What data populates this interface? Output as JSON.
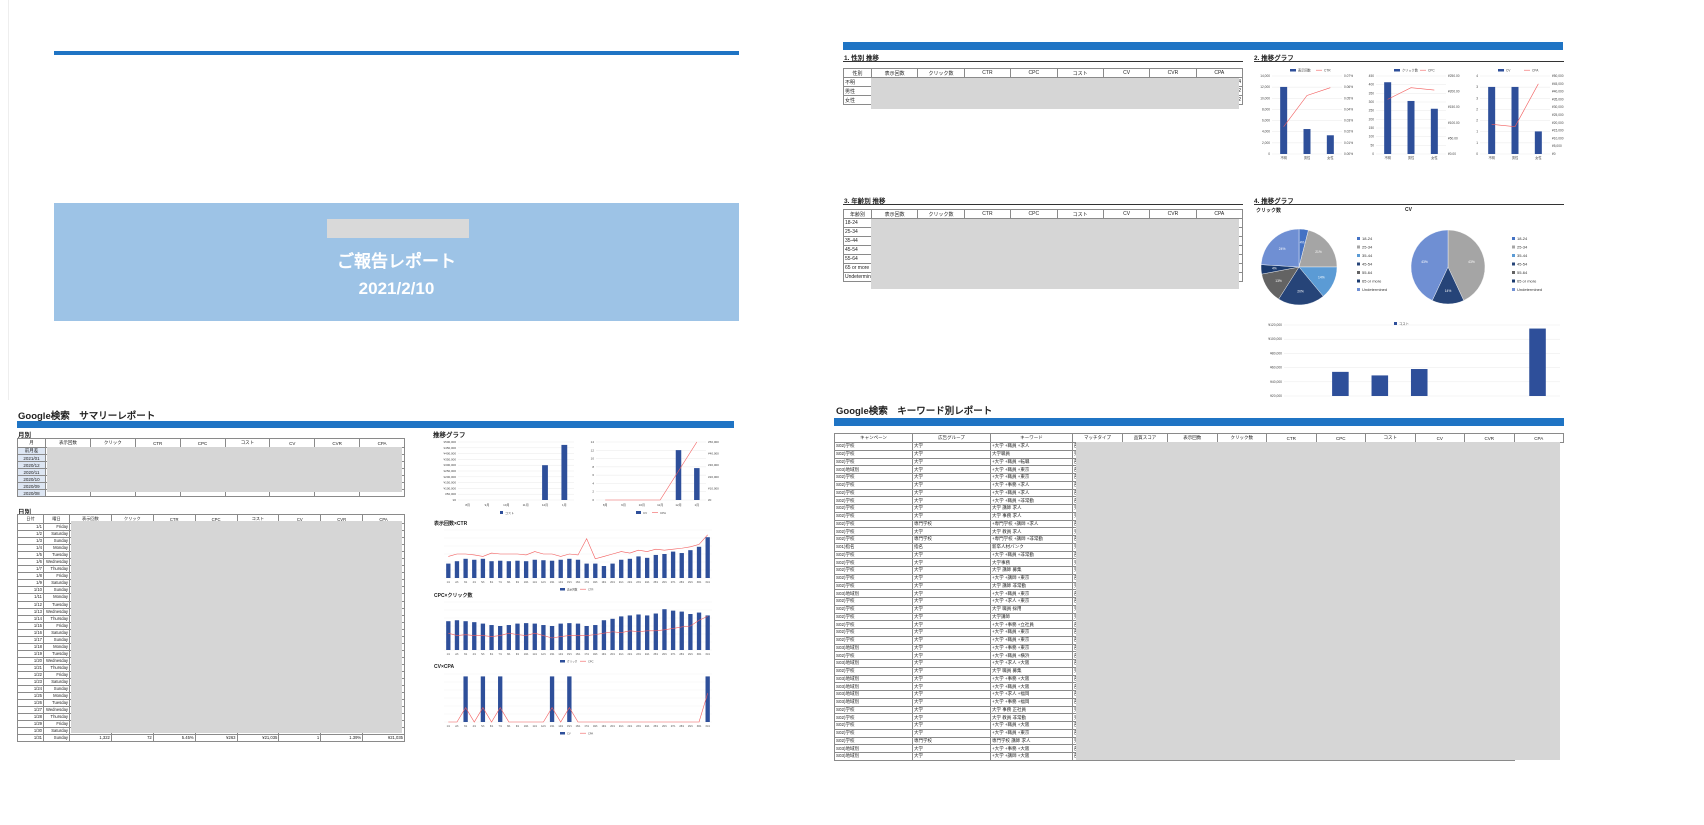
{
  "cover": {
    "title": "ご報告レポート",
    "date": "2021/2/10"
  },
  "gender": {
    "section": "1. 性別 推移",
    "graph_section": "2. 推移グラフ",
    "cols": [
      "性別",
      "表示回数",
      "クリック数",
      "CTR",
      "CPC",
      "コスト",
      "CV",
      "CVR",
      "CPA"
    ],
    "rows": [
      "不明",
      "男性",
      "女性"
    ],
    "right_vals": [
      "4",
      "2",
      "2"
    ],
    "charts": [
      {
        "legend": [
          "表示回数",
          "CTR"
        ],
        "yleft": [
          "14,000",
          "12,000",
          "10,000",
          "8,000",
          "6,000",
          "4,000",
          "2,000",
          "0"
        ],
        "yright": [
          "0.07%",
          "0.06%",
          "0.05%",
          "0.04%",
          "0.03%",
          "0.02%",
          "0.01%",
          "0.00%"
        ],
        "cats": [
          "不明",
          "男性",
          "女性"
        ],
        "values": [
          0.86,
          0.32,
          0.24
        ],
        "line": [
          0.35,
          0.75,
          0.85
        ]
      },
      {
        "legend": [
          "クリック数",
          "CPC"
        ],
        "yleft": [
          "450",
          "400",
          "350",
          "300",
          "250",
          "200",
          "150",
          "100",
          "50",
          "0"
        ],
        "yright": [
          "¥250.00",
          "¥200.00",
          "¥150.00",
          "¥100.00",
          "¥50.00",
          "¥0.00"
        ],
        "cats": [
          "不明",
          "男性",
          "女性"
        ],
        "values": [
          0.92,
          0.68,
          0.58
        ],
        "line": [
          0.7,
          0.85,
          0.82
        ]
      },
      {
        "legend": [
          "CV",
          "CPA"
        ],
        "yleft": [
          "4",
          "3",
          "3",
          "2",
          "2",
          "1",
          "1",
          "0"
        ],
        "yright": [
          "¥50,000",
          "¥45,000",
          "¥40,000",
          "¥35,000",
          "¥30,000",
          "¥25,000",
          "¥20,000",
          "¥15,000",
          "¥10,000",
          "¥5,000",
          "¥0"
        ],
        "cats": [
          "不明",
          "男性",
          "女性"
        ],
        "values": [
          0.86,
          0.86,
          0.29
        ],
        "line": [
          0.38,
          0.35,
          0.9
        ]
      }
    ]
  },
  "age": {
    "section": "3. 年齢別 推移",
    "graph_section": "4. 推移グラフ",
    "cols": [
      "年齢別",
      "表示回数",
      "クリック数",
      "CTR",
      "CPC",
      "コスト",
      "CV",
      "CVR",
      "CPA"
    ],
    "rows": [
      "18-24",
      "25-34",
      "35-44",
      "45-54",
      "55-64",
      "65 or more",
      "Undetermined"
    ],
    "pie1_title": "クリック数",
    "pie2_title": "CV",
    "legend": [
      "18-24",
      "25-34",
      "35-44",
      "45-54",
      "55-64",
      "65 or more",
      "Undetermined"
    ],
    "pie1": [
      4,
      21,
      14,
      20,
      13,
      4,
      24
    ],
    "pie1_labels": [
      "4%",
      "21%",
      "14%",
      "20%",
      "13%",
      "4%",
      "24%"
    ],
    "pie2": [
      0,
      43,
      0,
      14,
      0,
      0,
      43
    ],
    "pie2_labels": [
      "0%",
      "43%",
      "14%",
      "0%",
      "0%",
      "43%"
    ],
    "bar_legend": "コスト",
    "bar_y": [
      "¥120,000",
      "¥100,000",
      "¥80,000",
      "¥60,000",
      "¥40,000",
      "¥20,000"
    ],
    "bar_values": [
      0,
      0.34,
      0.29,
      0.38,
      0,
      0,
      0.95
    ]
  },
  "summary": {
    "title": "Google検索　サマリーレポート",
    "monthly_label": "月別",
    "daily_label": "日別",
    "graph_label": "推移グラフ",
    "monthly_cols": [
      "月",
      "表示回数",
      "クリック",
      "CTR",
      "CPC",
      "コスト",
      "CV",
      "CVR",
      "CPA"
    ],
    "months": [
      "前月差",
      "2021/01",
      "2020/12",
      "2020/11",
      "2020/10",
      "2020/09",
      "2020/08"
    ],
    "daily_cols": [
      "日付",
      "曜日",
      "表示回数",
      "クリック",
      "CTR",
      "CPC",
      "コスト",
      "CV",
      "CVR",
      "CPA"
    ],
    "days": [
      [
        "1/1",
        "Friday"
      ],
      [
        "1/2",
        "Saturday"
      ],
      [
        "1/3",
        "Sunday"
      ],
      [
        "1/4",
        "Monday"
      ],
      [
        "1/5",
        "Tuesday"
      ],
      [
        "1/6",
        "Wednesday"
      ],
      [
        "1/7",
        "Thursday"
      ],
      [
        "1/8",
        "Friday"
      ],
      [
        "1/9",
        "Saturday"
      ],
      [
        "1/10",
        "Sunday"
      ],
      [
        "1/11",
        "Monday"
      ],
      [
        "1/12",
        "Tuesday"
      ],
      [
        "1/13",
        "Wednesday"
      ],
      [
        "1/14",
        "Thursday"
      ],
      [
        "1/15",
        "Friday"
      ],
      [
        "1/16",
        "Saturday"
      ],
      [
        "1/17",
        "Sunday"
      ],
      [
        "1/18",
        "Monday"
      ],
      [
        "1/19",
        "Tuesday"
      ],
      [
        "1/20",
        "Wednesday"
      ],
      [
        "1/21",
        "Thursday"
      ],
      [
        "1/22",
        "Friday"
      ],
      [
        "1/23",
        "Saturday"
      ],
      [
        "1/24",
        "Sunday"
      ],
      [
        "1/25",
        "Monday"
      ],
      [
        "1/26",
        "Tuesday"
      ],
      [
        "1/27",
        "Wednesday"
      ],
      [
        "1/28",
        "Thursday"
      ],
      [
        "1/29",
        "Friday"
      ],
      [
        "1/30",
        "Saturday"
      ]
    ],
    "last_row": [
      "1/31",
      "Sunday",
      "1,322",
      "72",
      "5.45%",
      "¥263",
      "¥21,035",
      "1",
      "1.39%",
      "¥21,035"
    ],
    "chart1": {
      "y": [
        "¥500,000",
        "¥450,000",
        "¥400,000",
        "¥350,000",
        "¥300,000",
        "¥250,000",
        "¥200,000",
        "¥150,000",
        "¥100,000",
        "¥50,000",
        "¥0"
      ],
      "x": [
        "8月",
        "9月",
        "10月",
        "11月",
        "12月",
        "1月"
      ],
      "values": [
        0,
        0,
        0,
        0,
        0.6,
        0.95
      ],
      "legend": "コスト"
    },
    "chart2": {
      "yl": [
        "14",
        "12",
        "10",
        "8",
        "6",
        "4",
        "2",
        "0"
      ],
      "yr": [
        "¥50,000",
        "¥40,000",
        "¥30,000",
        "¥20,000",
        "¥10,000",
        "¥0"
      ],
      "x": [
        "8月",
        "9月",
        "10月",
        "11月",
        "12月",
        "1月"
      ],
      "values": [
        0,
        0,
        0,
        0,
        0.86,
        0.55
      ],
      "line": [
        0,
        0,
        0,
        0,
        0.5,
        1.0
      ],
      "legend": [
        "CV",
        "CPA"
      ]
    },
    "chart3_title": "表示回数×CTR",
    "chart4_title": "CPC×クリック数",
    "chart5_title": "CV×CPA",
    "c3_legend": [
      "表示回数",
      "CTR"
    ],
    "c4_legend": [
      "クリック",
      "CPC"
    ],
    "c5_legend": [
      "CV",
      "CPA"
    ]
  },
  "keyword": {
    "title": "Google検索　キーワード別レポート",
    "cols": [
      "キャンペーン",
      "広告グループ",
      "キーワード",
      "マッチタイプ",
      "品質スコア",
      "表示回数",
      "クリック数",
      "CTR",
      "CPC",
      "コスト",
      "CV",
      "CVR",
      "CPA"
    ],
    "rows": [
      [
        "S02)学校",
        "大学",
        "+大学 +職員 +求人",
        "部"
      ],
      [
        "S02)学校",
        "大学",
        "大学職員",
        "完"
      ],
      [
        "S02)学校",
        "大学",
        "+大学 +職員 +転職",
        "部"
      ],
      [
        "S03)地域別",
        "大学",
        "+大学 +職員 +東京",
        "部"
      ],
      [
        "S02)学校",
        "大学",
        "+大学 +職員 +東京",
        "部"
      ],
      [
        "S02)学校",
        "大学",
        "+大学 +事務 +求人",
        "部"
      ],
      [
        "S02)学校",
        "大学",
        "+大学 +職員 +求人",
        "部"
      ],
      [
        "S02)学校",
        "大学",
        "+大学 +職員 +非常勤",
        "部"
      ],
      [
        "S02)学校",
        "大学",
        "大学 講師 求人",
        "完"
      ],
      [
        "S02)学校",
        "大学",
        "大学 事務 求人",
        "完"
      ],
      [
        "S02)学校",
        "専門学校",
        "+専門学校 +講師 +求人",
        "部"
      ],
      [
        "S02)学校",
        "大学",
        "大学 教員 求人",
        "完"
      ],
      [
        "S02)学校",
        "専門学校",
        "+専門学校 +講師 +非常勤",
        "部"
      ],
      [
        "S01)指名",
        "指名",
        "新卒人材バンク",
        "完"
      ],
      [
        "S02)学校",
        "大学",
        "+大学 +職員 +非常勤",
        "部"
      ],
      [
        "S02)学校",
        "大学",
        "大学事務",
        "完"
      ],
      [
        "S02)学校",
        "大学",
        "大学 講師 募集",
        "完"
      ],
      [
        "S02)学校",
        "大学",
        "+大学 +講師 +東京",
        "部"
      ],
      [
        "S02)学校",
        "大学",
        "大学 講師 非常勤",
        "完"
      ],
      [
        "S03)地域別",
        "大学",
        "+大学 +職員 +東京",
        "部"
      ],
      [
        "S02)学校",
        "大学",
        "+大学 +求人 +東京",
        "部"
      ],
      [
        "S02)学校",
        "大学",
        "大学 職員 採用",
        "完"
      ],
      [
        "S02)学校",
        "大学",
        "大学講師",
        "完"
      ],
      [
        "S02)学校",
        "大学",
        "+大学 +事務 +立社員",
        "部"
      ],
      [
        "S02)学校",
        "大学",
        "+大学 +職員 +東京",
        "部"
      ],
      [
        "S02)学校",
        "大学",
        "+大学 +職員 +東京",
        "部"
      ],
      [
        "S03)地域別",
        "大学",
        "+大学 +事務 +東京",
        "部"
      ],
      [
        "S02)学校",
        "大学",
        "+大学 +職員 +横浜",
        "部"
      ],
      [
        "S03)地域別",
        "大学",
        "+大学 +求人 +大阪",
        "部"
      ],
      [
        "S02)学校",
        "大学",
        "大学 職員 募集",
        "完"
      ],
      [
        "S03)地域別",
        "大学",
        "+大学 +事務 +大阪",
        "部"
      ],
      [
        "S03)地域別",
        "大学",
        "+大学 +職員 +大阪",
        "部"
      ],
      [
        "S03)地域別",
        "大学",
        "+大学 +求人 +福岡",
        "部"
      ],
      [
        "S03)地域別",
        "大学",
        "+大学 +事務 +福岡",
        "部"
      ],
      [
        "S02)学校",
        "大学",
        "大学 事務 正社員",
        "完"
      ],
      [
        "S02)学校",
        "大学",
        "大学 教員 非常勤",
        "完"
      ],
      [
        "S02)学校",
        "大学",
        "+大学 +職員 +大阪",
        "部"
      ],
      [
        "S02)学校",
        "大学",
        "+大学 +職員 +東京",
        "部"
      ],
      [
        "S02)学校",
        "専門学校",
        "専門学校 講師 求人",
        "完"
      ],
      [
        "S03)地域別",
        "大学",
        "+大学 +事務 +大阪",
        "部"
      ],
      [
        "S03)地域別",
        "大学",
        "+大学 +講師 +大阪",
        "部"
      ]
    ],
    "right_marks": [
      "2",
      "2",
      "0",
      "4"
    ]
  }
}
